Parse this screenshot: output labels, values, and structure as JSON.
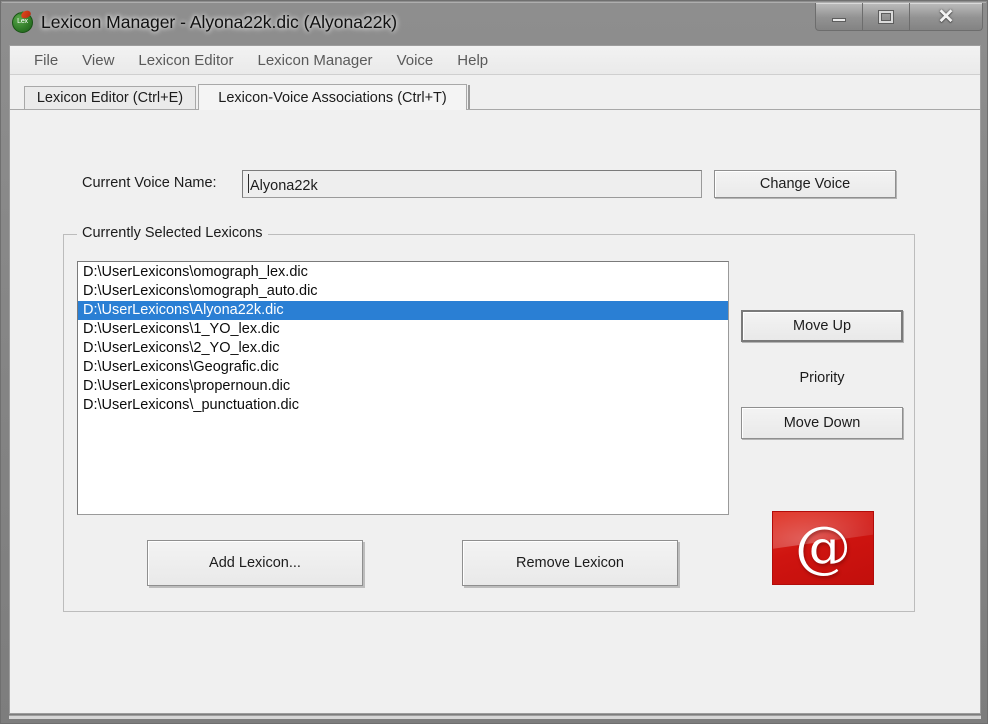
{
  "window": {
    "title": "Lexicon Manager - Alyona22k.dic (Alyona22k)",
    "icon": "lexicon-app-icon",
    "controls": {
      "minimize": "minimize-icon",
      "maximize": "maximize-icon",
      "close": "✕"
    }
  },
  "menubar": {
    "items": [
      {
        "label": "File"
      },
      {
        "label": "View"
      },
      {
        "label": "Lexicon Editor"
      },
      {
        "label": "Lexicon Manager"
      },
      {
        "label": "Voice"
      },
      {
        "label": "Help"
      }
    ]
  },
  "tabs": [
    {
      "label": "Lexicon Editor (Ctrl+E)",
      "active": false
    },
    {
      "label": "Lexicon-Voice Associations (Ctrl+T)",
      "active": true
    }
  ],
  "voice": {
    "label": "Current Voice Name:",
    "value": "Alyona22k",
    "placeholder": "",
    "change_button": "Change Voice"
  },
  "lexicons_group": {
    "label": "Currently Selected Lexicons",
    "items": [
      {
        "path": "D:\\UserLexicons\\omograph_lex.dic",
        "selected": false
      },
      {
        "path": "D:\\UserLexicons\\omograph_auto.dic",
        "selected": false
      },
      {
        "path": "D:\\UserLexicons\\Alyona22k.dic",
        "selected": true
      },
      {
        "path": "D:\\UserLexicons\\1_YO_lex.dic",
        "selected": false
      },
      {
        "path": "D:\\UserLexicons\\2_YO_lex.dic",
        "selected": false
      },
      {
        "path": "D:\\UserLexicons\\Geografic.dic",
        "selected": false
      },
      {
        "path": "D:\\UserLexicons\\propernoun.dic",
        "selected": false
      },
      {
        "path": "D:\\UserLexicons\\_punctuation.dic",
        "selected": false
      }
    ],
    "priority_label": "Priority",
    "move_up": "Move Up",
    "move_down": "Move Down",
    "add_lexicon": "Add Lexicon...",
    "remove_lexicon": "Remove Lexicon"
  },
  "logo": {
    "name": "at-symbol-logo",
    "glyph": "@",
    "color": "#cf1410"
  },
  "colors": {
    "selection": "#2a7fd4",
    "window_frame": "#838383",
    "client_bg": "#f0f0f0",
    "logo_red": "#cf1410"
  }
}
